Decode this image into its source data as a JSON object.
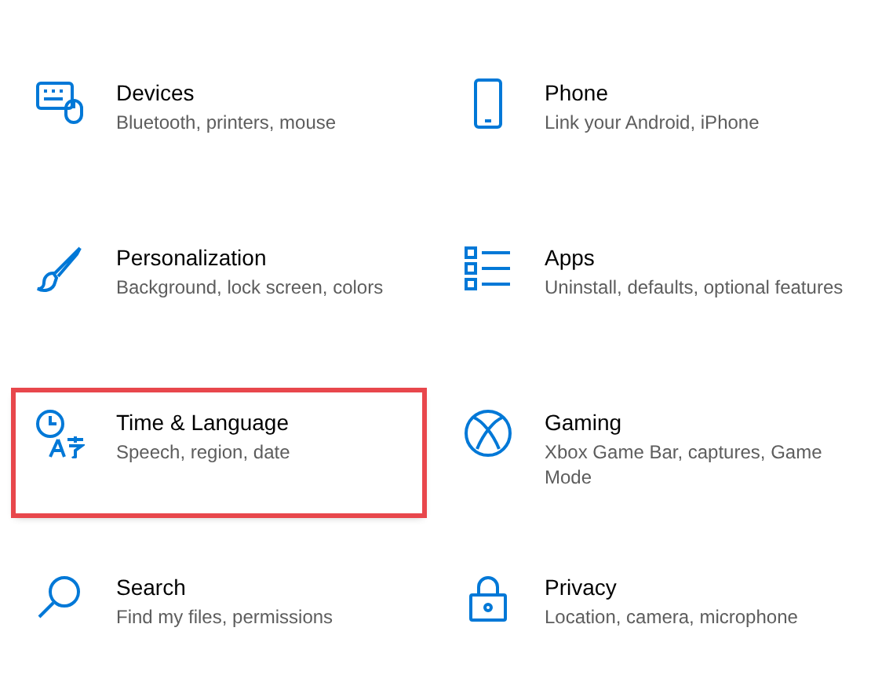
{
  "items": [
    {
      "kind": "devices",
      "title": "Devices",
      "subtitle": "Bluetooth, printers, mouse",
      "highlighted": false
    },
    {
      "kind": "phone",
      "title": "Phone",
      "subtitle": "Link your Android, iPhone",
      "highlighted": false
    },
    {
      "kind": "personalization",
      "title": "Personalization",
      "subtitle": "Background, lock screen, colors",
      "highlighted": false
    },
    {
      "kind": "apps",
      "title": "Apps",
      "subtitle": "Uninstall, defaults, optional features",
      "highlighted": false
    },
    {
      "kind": "time",
      "title": "Time & Language",
      "subtitle": "Speech, region, date",
      "highlighted": true
    },
    {
      "kind": "gaming",
      "title": "Gaming",
      "subtitle": "Xbox Game Bar, captures, Game Mode",
      "highlighted": false
    },
    {
      "kind": "search",
      "title": "Search",
      "subtitle": "Find my files, permissions",
      "highlighted": false
    },
    {
      "kind": "privacy",
      "title": "Privacy",
      "subtitle": "Location, camera, microphone",
      "highlighted": false
    }
  ]
}
